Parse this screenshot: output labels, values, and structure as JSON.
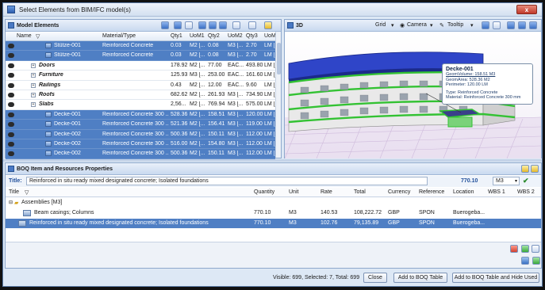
{
  "window": {
    "title": "Select Elements from BIM/IFC model(s)",
    "close_label": "x"
  },
  "model_panel": {
    "title": "Model Elements",
    "columns": [
      "Name",
      "Material/Type",
      "Qty1",
      "UoM1",
      "Qty2",
      "UoM2",
      "Qty3",
      "UoM3"
    ],
    "rows": [
      {
        "name": "Stütze-001",
        "material": "Reinforced Concrete",
        "qty1": "0.03",
        "uom1": "M2 [...",
        "qty2": "0.08",
        "uom2": "M3 [...",
        "qty3": "2.70",
        "uom3": "LM [...",
        "selected": true,
        "group": false
      },
      {
        "name": "Stütze-001",
        "material": "Reinforced Concrete",
        "qty1": "0.03",
        "uom1": "M2 [...",
        "qty2": "0.08",
        "uom2": "M3 [...",
        "qty3": "2.70",
        "uom3": "LM [...",
        "selected": true,
        "group": false
      },
      {
        "name": "Doors",
        "material": "",
        "qty1": "178.92",
        "uom1": "M2 [...",
        "qty2": "77.00",
        "uom2": "EAC...",
        "qty3": "493.80",
        "uom3": "LM [...",
        "selected": false,
        "group": true
      },
      {
        "name": "Furniture",
        "material": "",
        "qty1": "125.93",
        "uom1": "M3 [...",
        "qty2": "253.00",
        "uom2": "EAC...",
        "qty3": "161.60",
        "uom3": "LM [...",
        "selected": false,
        "group": true
      },
      {
        "name": "Railings",
        "material": "",
        "qty1": "0.43",
        "uom1": "M2 [...",
        "qty2": "12.00",
        "uom2": "EAC...",
        "qty3": "9.60",
        "uom3": "LM [...",
        "selected": false,
        "group": true
      },
      {
        "name": "Roofs",
        "material": "",
        "qty1": "682.62",
        "uom1": "M2 [...",
        "qty2": "261.93",
        "uom2": "M3 [...",
        "qty3": "734.90",
        "uom3": "LM [...",
        "selected": false,
        "group": true
      },
      {
        "name": "Slabs",
        "material": "",
        "qty1": "2,56...",
        "uom1": "M2 [...",
        "qty2": "769.94",
        "uom2": "M3 [...",
        "qty3": "575.00",
        "uom3": "LM [...",
        "selected": false,
        "group": true
      },
      {
        "name": "Decke-001",
        "material": "Reinforced Concrete 300 ...",
        "qty1": "528.36",
        "uom1": "M2 [...",
        "qty2": "158.51",
        "uom2": "M3 [...",
        "qty3": "120.00",
        "uom3": "LM [...",
        "selected": true,
        "group": false
      },
      {
        "name": "Decke-001",
        "material": "Reinforced Concrete 300 ...",
        "qty1": "521.36",
        "uom1": "M2 [...",
        "qty2": "156.41",
        "uom2": "M3 [...",
        "qty3": "119.00",
        "uom3": "LM [...",
        "selected": true,
        "group": false
      },
      {
        "name": "Decke-002",
        "material": "Reinforced Concrete 300 ...",
        "qty1": "500.36",
        "uom1": "M2 [...",
        "qty2": "150.11",
        "uom2": "M3 [...",
        "qty3": "112.00",
        "uom3": "LM [...",
        "selected": true,
        "group": false
      },
      {
        "name": "Decke-002",
        "material": "Reinforced Concrete 300 ...",
        "qty1": "516.00",
        "uom1": "M2 [...",
        "qty2": "154.80",
        "uom2": "M3 [...",
        "qty3": "112.00",
        "uom3": "LM [...",
        "selected": true,
        "group": false
      },
      {
        "name": "Decke-002",
        "material": "Reinforced Concrete 300 ...",
        "qty1": "500.36",
        "uom1": "M2 [...",
        "qty2": "150.11",
        "uom2": "M3 [...",
        "qty3": "112.00",
        "uom3": "LM [...",
        "selected": true,
        "group": false
      }
    ]
  },
  "view_panel": {
    "title": "3D",
    "grid_label": "Grid",
    "camera_label": "Camera",
    "tooltip_label": "Tooltip",
    "tooltip": {
      "title": "Decke-001",
      "geom_volume": "GeomVolume: 158.51 M3",
      "geom_area": "GeomArea: 528.36 M2",
      "perimeter": "Perimeter: 120.00 LM",
      "type": "Type: Reinforced Concrete",
      "material": "Material: Reinforced Concrete 300 mm"
    }
  },
  "boq_panel": {
    "title": "BOQ Item and Resources Properties",
    "title_label": "Title:",
    "title_value": "Reinforced in situ ready mixed designated concrete; Isolated foundations",
    "quantity": "770.10",
    "unit": "M3",
    "columns": [
      "Title",
      "Quantity",
      "Unit",
      "Rate",
      "Total",
      "Currency",
      "Reference",
      "Location",
      "WBS 1",
      "WBS 2"
    ],
    "assembly": "Assemblies [M3]",
    "rows": [
      {
        "title": "Beam casings; Columns",
        "quantity": "770.10",
        "unit": "M3",
        "rate": "140.53",
        "total": "108,222.72",
        "currency": "GBP",
        "reference": "SPON",
        "location": "Buerogeba...",
        "selected": false
      },
      {
        "title": "Reinforced in situ ready mixed designated concrete; Isolated foundations",
        "quantity": "770.10",
        "unit": "M3",
        "rate": "102.76",
        "total": "79,135.89",
        "currency": "GBP",
        "reference": "SPON",
        "location": "Buerogeba...",
        "selected": true
      }
    ]
  },
  "status": {
    "text": "Visible: 699, Selected: 7, Total: 699",
    "close_label": "Close",
    "add_label": "Add to BOQ Table",
    "add_hide_label": "Add to BOQ Table and Hide Used"
  }
}
